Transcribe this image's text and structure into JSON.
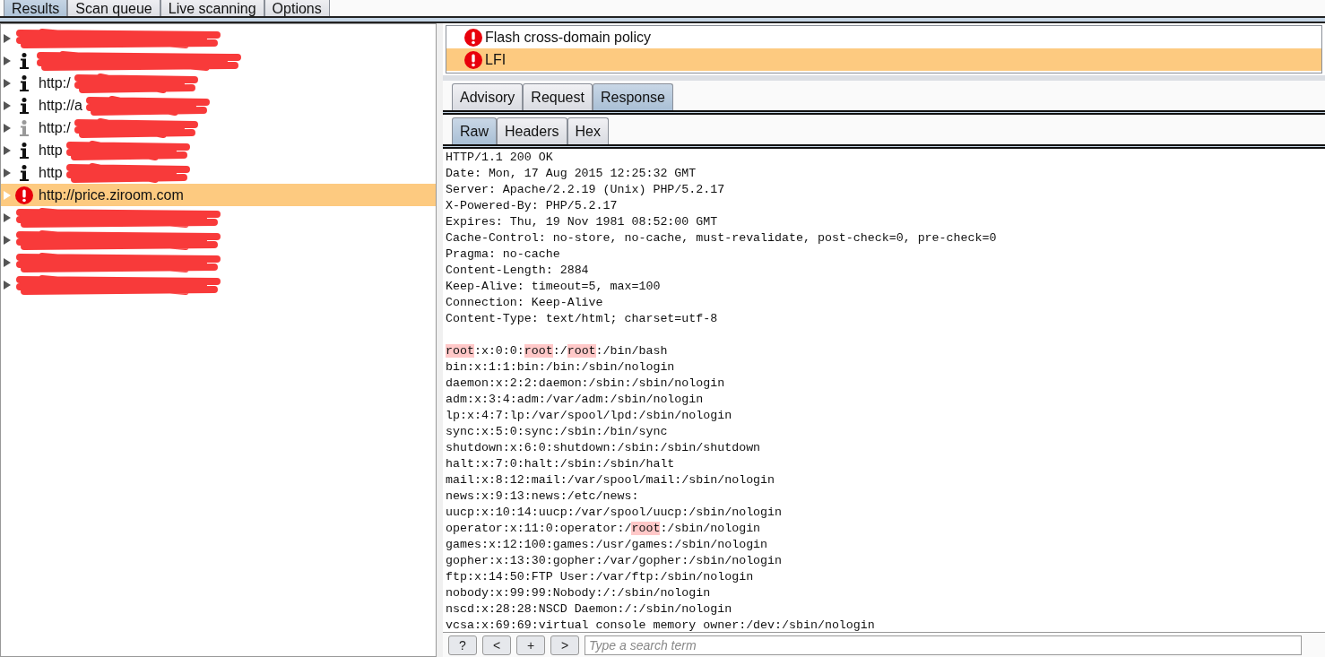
{
  "top_tabs": [
    {
      "label": "Results",
      "selected": true
    },
    {
      "label": "Scan queue",
      "selected": false
    },
    {
      "label": "Live scanning",
      "selected": false
    },
    {
      "label": "Options",
      "selected": false
    }
  ],
  "hosts": [
    {
      "selected": false,
      "redacted": true
    },
    {
      "kind": "info",
      "selected": false,
      "redacted": true
    },
    {
      "kind": "info",
      "selected": false,
      "label": "http:/",
      "redacted": true
    },
    {
      "kind": "info",
      "selected": false,
      "label": "http://a",
      "redacted": true
    },
    {
      "kind": "info-grey",
      "selected": false,
      "label": "http:/",
      "redacted": true
    },
    {
      "kind": "info",
      "selected": false,
      "label": "http",
      "redacted": true
    },
    {
      "kind": "info",
      "selected": false,
      "label": "http",
      "redacted": true
    },
    {
      "kind": "alert",
      "selected": true,
      "label": "http://price.ziroom.com",
      "redacted": false
    },
    {
      "selected": false,
      "redacted": true
    },
    {
      "selected": false,
      "redacted": true
    },
    {
      "selected": false,
      "redacted": true
    },
    {
      "selected": false,
      "redacted": true
    }
  ],
  "issues": [
    {
      "label": "Flash cross-domain policy",
      "selected": false
    },
    {
      "label": "LFI",
      "selected": true
    }
  ],
  "detail_tabs": [
    {
      "label": "Advisory",
      "selected": false
    },
    {
      "label": "Request",
      "selected": false
    },
    {
      "label": "Response",
      "selected": true
    }
  ],
  "view_tabs": [
    {
      "label": "Raw",
      "selected": true
    },
    {
      "label": "Headers",
      "selected": false
    },
    {
      "label": "Hex",
      "selected": false
    }
  ],
  "response": {
    "headers": [
      "HTTP/1.1 200 OK",
      "Date: Mon, 17 Aug 2015 12:25:32 GMT",
      "Server: Apache/2.2.19 (Unix) PHP/5.2.17",
      "X-Powered-By: PHP/5.2.17",
      "Expires: Thu, 19 Nov 1981 08:52:00 GMT",
      "Cache-Control: no-store, no-cache, must-revalidate, post-check=0, pre-check=0",
      "Pragma: no-cache",
      "Content-Length: 2884",
      "Keep-Alive: timeout=5, max=100",
      "Connection: Keep-Alive",
      "Content-Type: text/html; charset=utf-8"
    ],
    "body": [
      [
        {
          "text": "root",
          "match": true
        },
        {
          "text": ":x:0:0:",
          "match": false
        },
        {
          "text": "root",
          "match": true
        },
        {
          "text": ":/",
          "match": false
        },
        {
          "text": "root",
          "match": true
        },
        {
          "text": ":/bin/bash",
          "match": false
        }
      ],
      [
        {
          "text": "bin:x:1:1:bin:/bin:/sbin/nologin",
          "match": false
        }
      ],
      [
        {
          "text": "daemon:x:2:2:daemon:/sbin:/sbin/nologin",
          "match": false
        }
      ],
      [
        {
          "text": "adm:x:3:4:adm:/var/adm:/sbin/nologin",
          "match": false
        }
      ],
      [
        {
          "text": "lp:x:4:7:lp:/var/spool/lpd:/sbin/nologin",
          "match": false
        }
      ],
      [
        {
          "text": "sync:x:5:0:sync:/sbin:/bin/sync",
          "match": false
        }
      ],
      [
        {
          "text": "shutdown:x:6:0:shutdown:/sbin:/sbin/shutdown",
          "match": false
        }
      ],
      [
        {
          "text": "halt:x:7:0:halt:/sbin:/sbin/halt",
          "match": false
        }
      ],
      [
        {
          "text": "mail:x:8:12:mail:/var/spool/mail:/sbin/nologin",
          "match": false
        }
      ],
      [
        {
          "text": "news:x:9:13:news:/etc/news:",
          "match": false
        }
      ],
      [
        {
          "text": "uucp:x:10:14:uucp:/var/spool/uucp:/sbin/nologin",
          "match": false
        }
      ],
      [
        {
          "text": "operator:x:11:0:operator:/",
          "match": false
        },
        {
          "text": "root",
          "match": true
        },
        {
          "text": ":/sbin/nologin",
          "match": false
        }
      ],
      [
        {
          "text": "games:x:12:100:games:/usr/games:/sbin/nologin",
          "match": false
        }
      ],
      [
        {
          "text": "gopher:x:13:30:gopher:/var/gopher:/sbin/nologin",
          "match": false
        }
      ],
      [
        {
          "text": "ftp:x:14:50:FTP User:/var/ftp:/sbin/nologin",
          "match": false
        }
      ],
      [
        {
          "text": "nobody:x:99:99:Nobody:/:/sbin/nologin",
          "match": false
        }
      ],
      [
        {
          "text": "nscd:x:28:28:NSCD Daemon:/:/sbin/nologin",
          "match": false
        }
      ],
      [
        {
          "text": "vcsa:x:69:69:virtual console memory owner:/dev:/sbin/nologin",
          "match": false
        }
      ]
    ]
  },
  "search_bar": {
    "buttons": [
      "?",
      "<",
      "+",
      ">"
    ],
    "placeholder": "Type a search term"
  }
}
